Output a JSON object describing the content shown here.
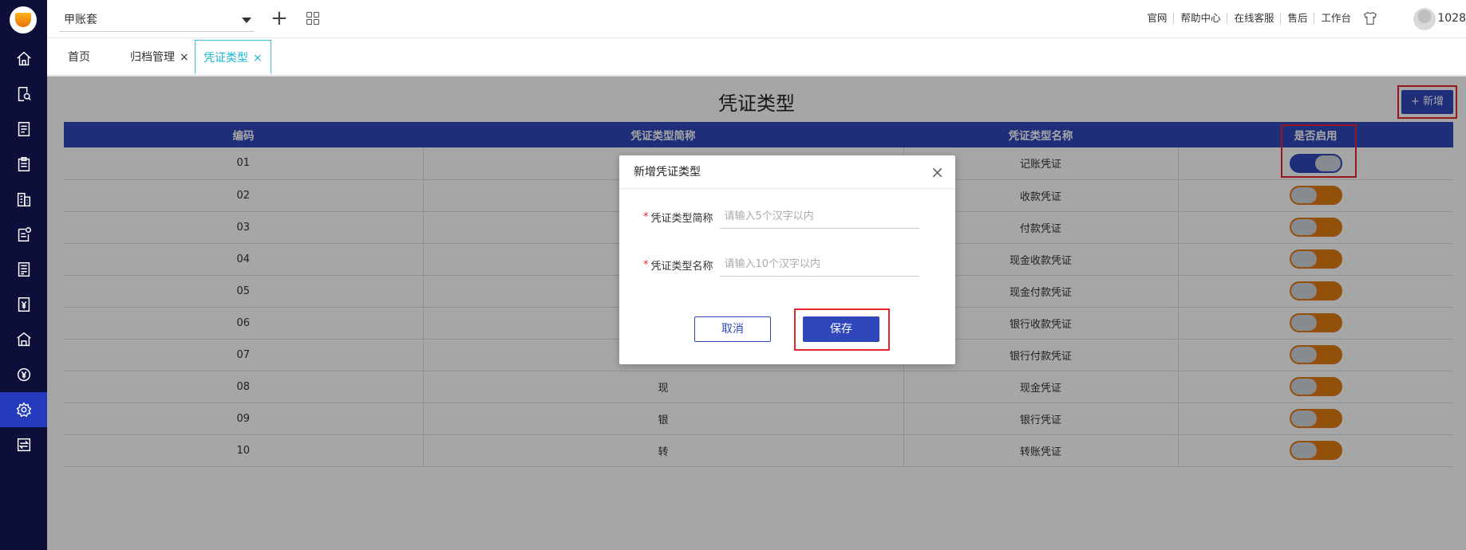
{
  "sidebar": {
    "logo": "logo",
    "items": [
      {
        "icon": "home-icon"
      },
      {
        "icon": "search-document-icon"
      },
      {
        "icon": "ledger-icon"
      },
      {
        "icon": "clipboard-icon"
      },
      {
        "icon": "building-icon"
      },
      {
        "icon": "document-settings-icon"
      },
      {
        "icon": "report-icon"
      },
      {
        "icon": "yen-document-icon"
      },
      {
        "icon": "bank-icon"
      },
      {
        "icon": "yen-circle-icon"
      },
      {
        "icon": "gear-icon",
        "active": true
      },
      {
        "icon": "transfer-icon"
      }
    ]
  },
  "topbar": {
    "account": "甲账套",
    "links": [
      "官网",
      "帮助中心",
      "在线客服",
      "售后",
      "工作台"
    ],
    "user": "1028"
  },
  "tabs": [
    {
      "label": "首页"
    },
    {
      "label": "归档管理",
      "closable": true
    },
    {
      "label": "凭证类型",
      "closable": true,
      "active": true
    }
  ],
  "page": {
    "title": "凭证类型",
    "add_label": "新增",
    "columns": [
      "编码",
      "凭证类型简称",
      "凭证类型名称",
      "是否启用"
    ],
    "rows": [
      {
        "code": "01",
        "short": "",
        "name": "记账凭证",
        "enabled": true
      },
      {
        "code": "02",
        "short": "",
        "name": "收款凭证",
        "enabled": false
      },
      {
        "code": "03",
        "short": "",
        "name": "付款凭证",
        "enabled": false
      },
      {
        "code": "04",
        "short": "",
        "name": "现金收款凭证",
        "enabled": false
      },
      {
        "code": "05",
        "short": "",
        "name": "现金付款凭证",
        "enabled": false
      },
      {
        "code": "06",
        "short": "",
        "name": "银行收款凭证",
        "enabled": false
      },
      {
        "code": "07",
        "short": "",
        "name": "银行付款凭证",
        "enabled": false
      },
      {
        "code": "08",
        "short": "现",
        "name": "现金凭证",
        "enabled": false
      },
      {
        "code": "09",
        "short": "银",
        "name": "银行凭证",
        "enabled": false
      },
      {
        "code": "10",
        "short": "转",
        "name": "转账凭证",
        "enabled": false
      }
    ]
  },
  "modal": {
    "title": "新增凭证类型",
    "close": "×",
    "required_mark": "*",
    "short_label": "凭证类型简称",
    "short_placeholder": "请输入5个汉字以内",
    "name_label": "凭证类型名称",
    "name_placeholder": "请输入10个汉字以内",
    "cancel_label": "取消",
    "save_label": "保存"
  },
  "colors": {
    "sidebar_bg": "#0d0f3a",
    "primary": "#2f47bb",
    "toggle_off": "#e07b10",
    "highlight": "#e3262d",
    "tab_active": "#18b3d2"
  }
}
